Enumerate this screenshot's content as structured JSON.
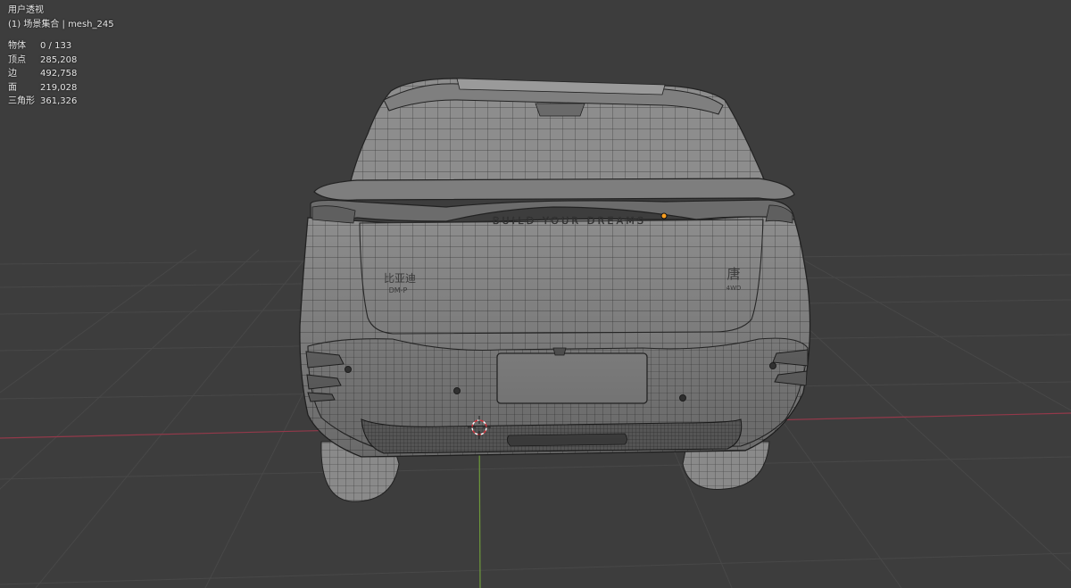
{
  "viewport": {
    "view_name": "用户透视",
    "collection_line": "(1) 场景集合 | mesh_245"
  },
  "stats": [
    {
      "label": "物体",
      "value": "0 / 133"
    },
    {
      "label": "顶点",
      "value": "285,208"
    },
    {
      "label": "边",
      "value": "492,758"
    },
    {
      "label": "面",
      "value": "219,028"
    },
    {
      "label": "三角形",
      "value": "361,326"
    }
  ],
  "model": {
    "rear_slogan": "BUILD YOUR DREAMS",
    "left_badge": "比亚迪",
    "left_badge_sub": "DM-P",
    "right_badge": "唐",
    "right_badge_sub": "4WD"
  },
  "colors": {
    "background": "#3d3d3d",
    "grid": "#4a4a4a",
    "x_axis": "#9b3b48",
    "y_axis": "#6f9a3a",
    "mesh_fill": "#8e8e8e",
    "mesh_wire": "#2b2b2b",
    "origin": "#ffa020"
  },
  "icons": {
    "cursor": "3d-cursor-icon",
    "origin": "object-origin-icon"
  }
}
